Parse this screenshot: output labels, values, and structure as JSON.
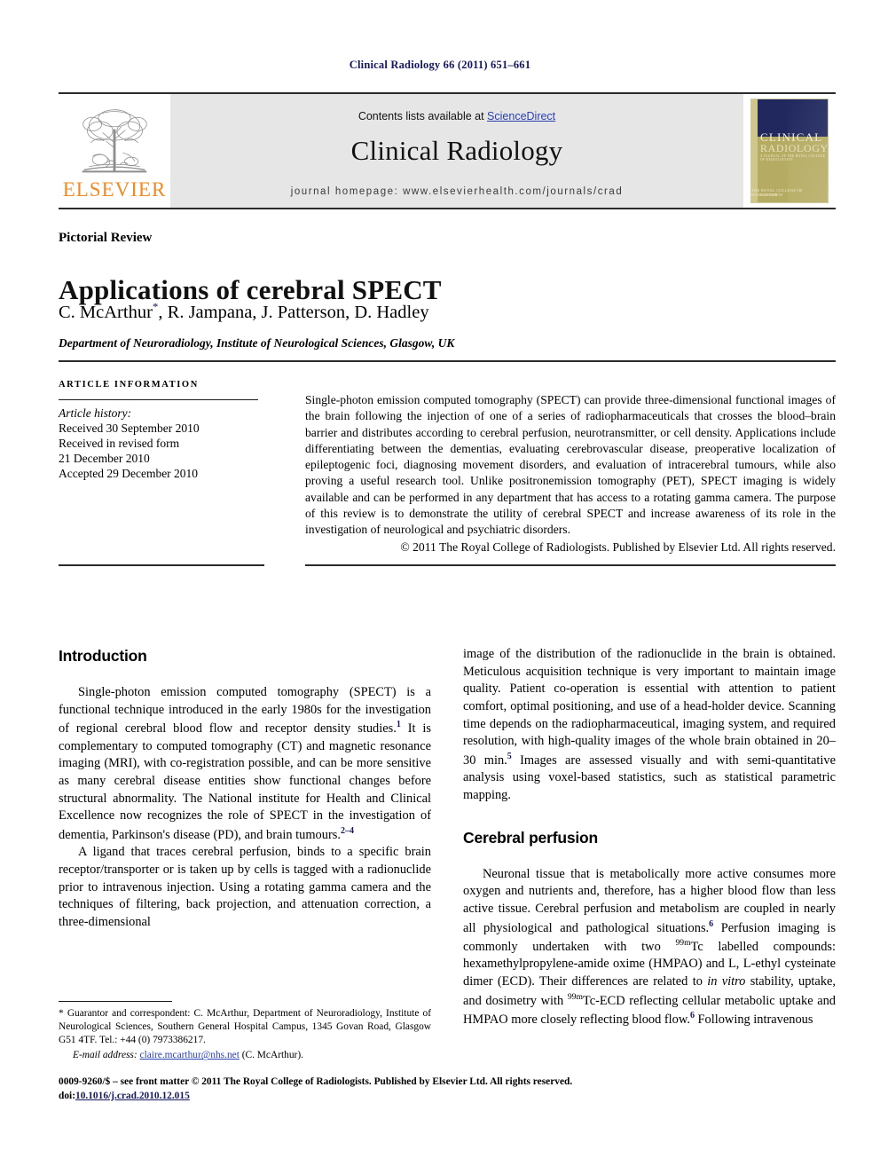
{
  "running_head": "Clinical Radiology 66 (2011) 651–661",
  "masthead": {
    "publisher_name": "ELSEVIER",
    "publisher_logo_icon": "elsevier-tree-icon",
    "contents_prefix": "Contents lists available at ",
    "contents_link": "ScienceDirect",
    "journal_name": "Clinical Radiology",
    "homepage": "journal homepage: www.elsevierhealth.com/journals/crad",
    "cover": {
      "line1": "CLINICAL",
      "line2": "RADIOLOGY",
      "line3": "A JOURNAL OF THE ROYAL COLLEGE OF RADIOLOGISTS",
      "foot_left": "ELSEVIER",
      "foot_right": "THE ROYAL COLLEGE OF RADIOLOGISTS",
      "band_color": "#20285e",
      "body_color": "#b5ab62"
    }
  },
  "article": {
    "type": "Pictorial Review",
    "title": "Applications of cerebral SPECT",
    "authors": "C. McArthur",
    "authors_star": "*",
    "authors_rest": ", R. Jampana, J. Patterson, D. Hadley",
    "affiliation": "Department of Neuroradiology, Institute of Neurological Sciences, Glasgow, UK"
  },
  "article_information": {
    "heading": "ARTICLE INFORMATION",
    "history_label": "Article history:",
    "history_lines": [
      "Received 30 September 2010",
      "Received in revised form",
      "21 December 2010",
      "Accepted 29 December 2010"
    ]
  },
  "abstract": {
    "text": "Single-photon emission computed tomography (SPECT) can provide three-dimensional functional images of the brain following the injection of one of a series of radiopharmaceuticals that crosses the blood–brain barrier and distributes according to cerebral perfusion, neurotransmitter, or cell density. Applications include differentiating between the dementias, evaluating cerebrovascular disease, preoperative localization of epileptogenic foci, diagnosing movement disorders, and evaluation of intracerebral tumours, while also proving a useful research tool. Unlike positronemission tomography (PET), SPECT imaging is widely available and can be performed in any department that has access to a rotating gamma camera. The purpose of this review is to demonstrate the utility of cerebral SPECT and increase awareness of its role in the investigation of neurological and psychiatric disorders.",
    "copyright": "© 2011 The Royal College of Radiologists. Published by Elsevier Ltd. All rights reserved."
  },
  "body": {
    "left_column": {
      "heading": "Introduction",
      "paragraph_1_a": "Single-photon emission computed tomography (SPECT) is a functional technique introduced in the early 1980s for the investigation of regional cerebral blood flow and receptor density studies.",
      "paragraph_1_ref1": "1",
      "paragraph_1_b": " It is complementary to computed tomography (CT) and magnetic resonance imaging (MRI), with co-registration possible, and can be more sensitive as many cerebral disease entities show functional changes before structural abnormality. The National institute for Health and Clinical Excellence now recognizes the role of SPECT in the investigation of dementia, Parkinson's disease (PD), and brain tumours.",
      "paragraph_1_ref2": "2–4",
      "paragraph_2": "A ligand that traces cerebral perfusion, binds to a specific brain receptor/transporter or is taken up by cells is tagged with a radionuclide prior to intravenous injection. Using a rotating gamma camera and the techniques of filtering, back projection, and attenuation correction, a three-dimensional"
    },
    "right_column": {
      "paragraph_1_a": "image of the distribution of the radionuclide in the brain is obtained. Meticulous acquisition technique is very important to maintain image quality. Patient co-operation is essential with attention to patient comfort, optimal positioning, and use of a head-holder device. Scanning time depends on the radiopharmaceutical, imaging system, and required resolution, with high-quality images of the whole brain obtained in 20–30 min.",
      "paragraph_1_ref": "5",
      "paragraph_1_b": " Images are assessed visually and with semi-quantitative analysis using voxel-based statistics, such as statistical parametric mapping.",
      "heading": "Cerebral perfusion",
      "paragraph_2_a": "Neuronal tissue that is metabolically more active consumes more oxygen and nutrients and, therefore, has a higher blood flow than less active tissue. Cerebral perfusion and metabolism are coupled in nearly all physiological and pathological situations.",
      "paragraph_2_ref6a": "6",
      "paragraph_2_b": " Perfusion imaging is commonly undertaken with two ",
      "paragraph_2_iso1": "99m",
      "paragraph_2_c": "Tc labelled compounds: hexamethylpropylene-amide oxime (HMPAO) and L, L-ethyl cysteinate dimer (ECD). Their differences are related to ",
      "paragraph_2_italic": "in vitro",
      "paragraph_2_d": " stability, uptake, and dosimetry with ",
      "paragraph_2_iso2": "99m",
      "paragraph_2_e": "Tc-ECD reflecting cellular metabolic uptake and HMPAO more closely reflecting blood flow.",
      "paragraph_2_ref6b": "6",
      "paragraph_2_f": " Following intravenous"
    }
  },
  "footnote": {
    "star": "*",
    "text": " Guarantor and correspondent: C. McArthur, Department of Neuroradiology, Institute of Neurological Sciences, Southern General Hospital Campus, 1345 Govan Road, Glasgow G51 4TF. Tel.: +44 (0) 7973386217.",
    "email_label": "E-mail address:",
    "email": "claire.mcarthur@nhs.net",
    "email_suffix": " (C. McArthur)."
  },
  "colophon": {
    "line1": "0009-9260/$ – see front matter © 2011 The Royal College of Radiologists. Published by Elsevier Ltd. All rights reserved.",
    "doi_label": "doi:",
    "doi_value": "10.1016/j.crad.2010.12.015"
  },
  "colors": {
    "link_blue": "#2a3fb0",
    "reference_navy": "#15175e",
    "elsevier_orange": "#f08a22",
    "masthead_grey": "#e6e6e6"
  }
}
